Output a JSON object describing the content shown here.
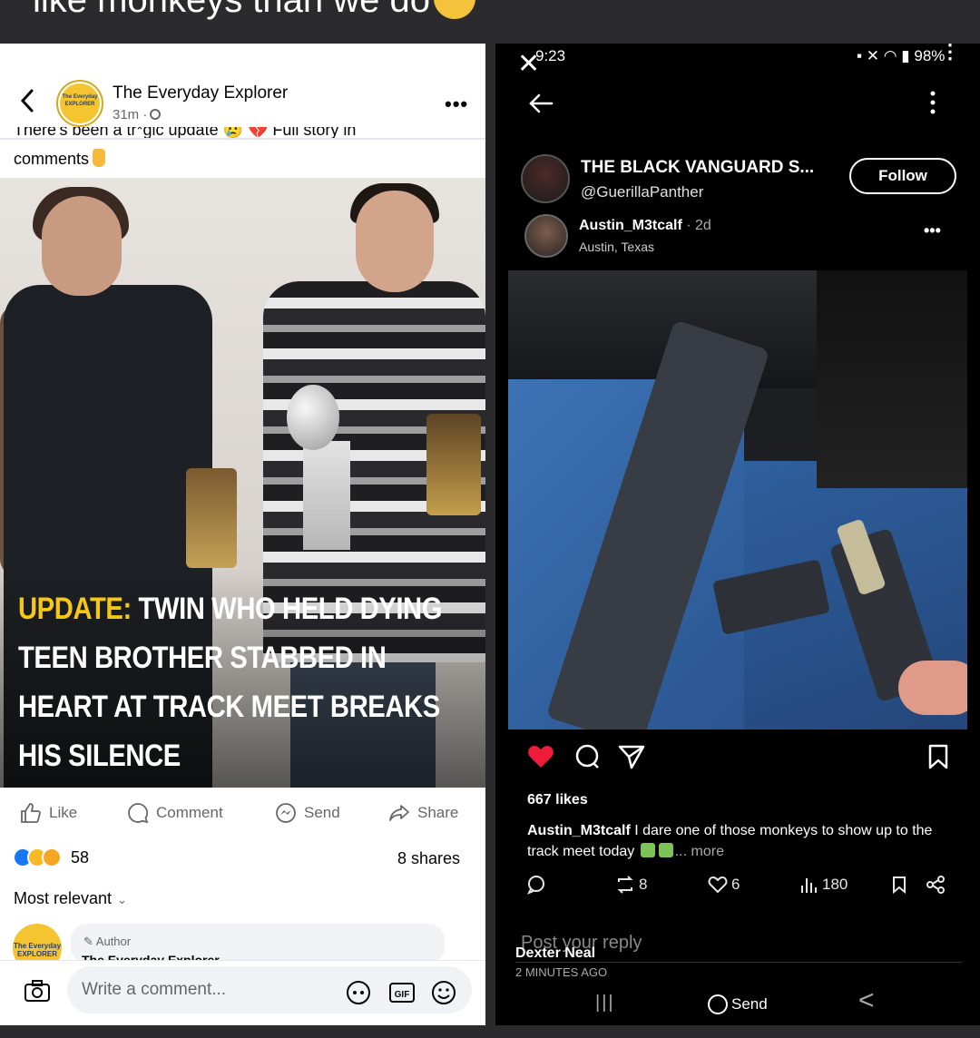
{
  "caption": {
    "text": "like monkeys than we do"
  },
  "facebook": {
    "page_name": "The Everyday Explorer",
    "time": "31m ·",
    "logo_text": "The Everyday EXPLORER",
    "more_label": "•••",
    "truncated_text": "There's been a tr*gic update 😢 💔 Full story in",
    "comments_text": "comments",
    "headline_accent": "UPDATE:",
    "headline_rest": " TWIN WHO HELD DYING TEEN BROTHER STABBED IN HEART AT TRACK MEET BREAKS HIS SILENCE",
    "actions": {
      "like": "Like",
      "comment": "Comment",
      "send": "Send",
      "share": "Share"
    },
    "reactions_count": "58",
    "shares": "8 shares",
    "sort_label": "Most relevant",
    "comment_author_tag": "Author",
    "comment_author_name": "The Everyday Explorer",
    "composer_placeholder": "Write a comment...",
    "gif_label": "GIF"
  },
  "threads": {
    "status_time": "9:23",
    "status_right": "98%",
    "account_name": "THE BLACK VANGUARD S...",
    "account_handle": "@GuerillaPanther",
    "follow_label": "Follow",
    "post_user": "Austin_M3tcalf",
    "post_ago": " · 2d",
    "post_location": "Austin, Texas",
    "post_more": "•••",
    "likes": "667 likes",
    "caption_user": "Austin_M3tcalf",
    "caption_text": " I dare one of those monkeys to show up to the track meet today",
    "caption_more": "... more",
    "stats": {
      "reposts": "8",
      "likes": "6",
      "views": "180"
    },
    "reply_placeholder": "Post your reply",
    "commenter": "Dexter Neal",
    "comment_ago": "2 MINUTES AGO",
    "nav_menu": "|||",
    "send_label": "Send",
    "nav_back": "<"
  },
  "colors": {
    "facebook_blue": "#1877f2",
    "headline_yellow": "#f5c816",
    "heart_red": "#ed1c3a"
  }
}
